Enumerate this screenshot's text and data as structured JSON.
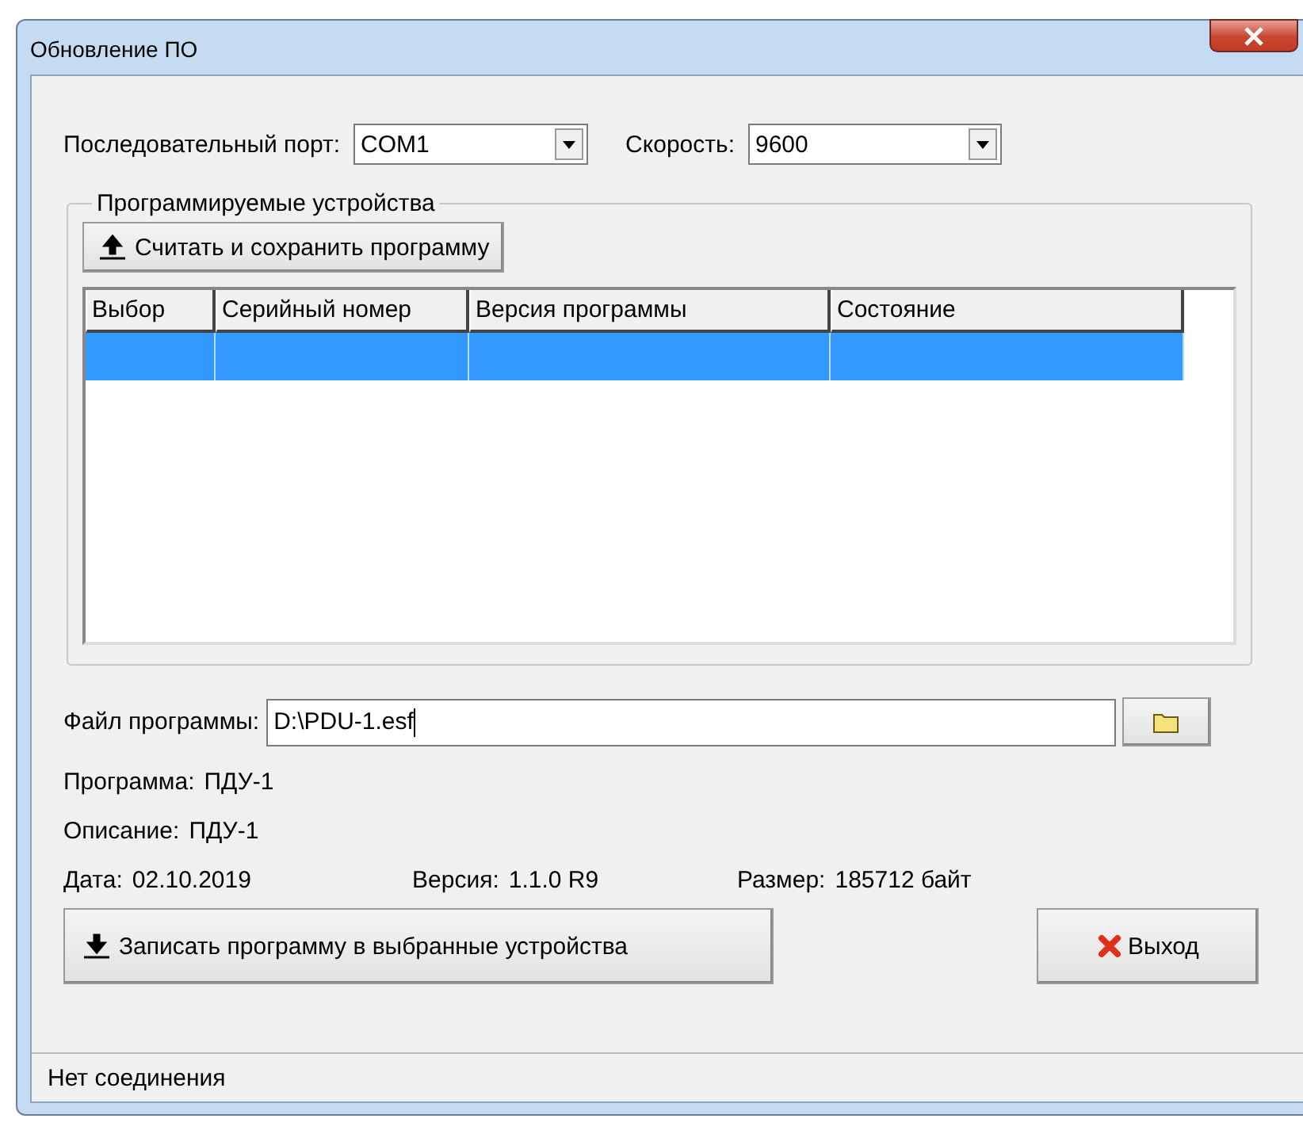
{
  "window": {
    "title": "Обновление ПО"
  },
  "port": {
    "label": "Последовательный порт:",
    "value": "COM1"
  },
  "speed": {
    "label": "Скорость:",
    "value": "9600"
  },
  "devices": {
    "title": "Программируемые устройства",
    "read_button": "Считать и сохранить программу",
    "table": {
      "columns": [
        "Выбор",
        "Серийный номер",
        "Версия программы",
        "Состояние"
      ],
      "rows": [
        {
          "selected": true
        }
      ]
    }
  },
  "file": {
    "label": "Файл программы:",
    "value": "D:\\PDU-1.esf"
  },
  "info": [
    {
      "label": "Программа:",
      "value": "ПДУ-1"
    },
    {
      "label": "Описание:",
      "value": "ПДУ-1"
    }
  ],
  "details": [
    {
      "label": "Дата:",
      "value": "02.10.2019"
    },
    {
      "label": "Версия:",
      "value": "1.1.0 R9"
    },
    {
      "label": "Размер:",
      "value": "185712 байт"
    }
  ],
  "write_button": "Записать программу в выбранные устройства",
  "exit_button": "Выход",
  "status_bar": "Нет соединения"
}
